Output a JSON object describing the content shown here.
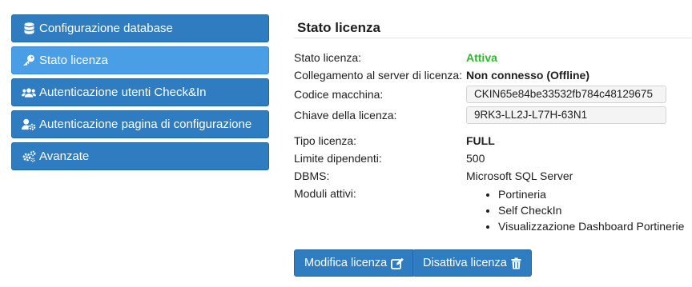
{
  "sidebar": {
    "items": [
      {
        "label": "Configurazione database",
        "icon": "database-icon"
      },
      {
        "label": "Stato licenza",
        "icon": "key-icon",
        "active": true
      },
      {
        "label": "Autenticazione utenti Check&In",
        "icon": "users-icon"
      },
      {
        "label": "Autenticazione pagina di configurazione",
        "icon": "user-gear-icon"
      },
      {
        "label": "Avanzate",
        "icon": "gears-icon"
      }
    ]
  },
  "main": {
    "title": "Stato licenza",
    "license_status_label": "Stato licenza:",
    "license_status_value": "Attiva",
    "server_label": "Collegamento al server di licenza:",
    "server_value": "Non connesso (Offline)",
    "machine_code_label": "Codice macchina:",
    "machine_code_value": "CKIN65e84be33532fb784c48129675",
    "license_key_label": "Chiave della licenza:",
    "license_key_value": "9RK3-LL2J-L77H-63N1",
    "license_type_label": "Tipo licenza:",
    "license_type_value": "FULL",
    "employee_limit_label": "Limite dipendenti:",
    "employee_limit_value": "500",
    "dbms_label": "DBMS:",
    "dbms_value": "Microsoft SQL Server",
    "modules_label": "Moduli attivi:",
    "modules": [
      "Portineria",
      "Self CheckIn",
      "Visualizzazione Dashboard Portinerie"
    ]
  },
  "actions": {
    "edit_label": "Modifica licenza",
    "deactivate_label": "Disattiva licenza"
  },
  "colors": {
    "primary": "#2f7dc0",
    "active_nav": "#4a9ee6",
    "status_active": "#2eb82e"
  }
}
